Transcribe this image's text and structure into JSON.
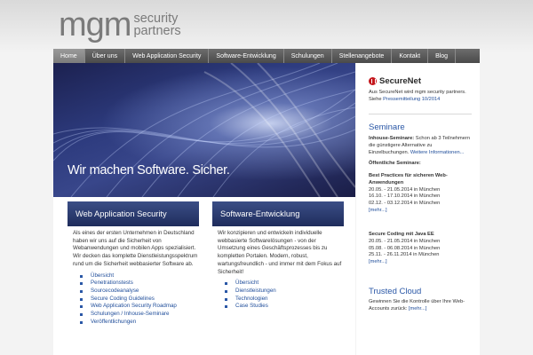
{
  "logo": {
    "main": "mgm",
    "sub1": "security",
    "sub2": "partners"
  },
  "nav": [
    {
      "label": "Home",
      "active": true
    },
    {
      "label": "Über uns",
      "active": false
    },
    {
      "label": "Web Application Security",
      "active": false
    },
    {
      "label": "Software-Entwicklung",
      "active": false
    },
    {
      "label": "Schulungen",
      "active": false
    },
    {
      "label": "Stellenangebote",
      "active": false
    },
    {
      "label": "Kontakt",
      "active": false
    },
    {
      "label": "Blog",
      "active": false
    }
  ],
  "hero": {
    "title": "Wir machen Software. Sicher."
  },
  "col1": {
    "heading": "Web Application Security",
    "text": "Als eines der ersten Unternehmen in Deutschland haben wir uns auf die Sicherheit von Webanwendungen und mobilen Apps spezialisiert. Wir decken das komplette Dienstleistungsspektrum rund um die Sicherheit webbasierter Software ab.",
    "links": [
      "Übersicht",
      "Penetrationstests",
      "Sourcecodeanalyse",
      "Secure Coding Guidelines",
      "Web Application Security Roadmap",
      "Schulungen / Inhouse-Seminare",
      "Veröffentlichungen"
    ]
  },
  "col2": {
    "heading": "Software-Entwicklung",
    "text": "Wir konzipieren und entwickeln individuelle webbasierte Softwarelösungen - von der Umsetzung eines Geschäftsprozesses bis zu kompletten Portalen. Modern, robust, wartungsfreundlich - und immer mit dem Fokus auf Sicherheit!",
    "links": [
      "Übersicht",
      "Dienstleistungen",
      "Technologien",
      "Case Studies"
    ]
  },
  "sidebar": {
    "securenet_title": "SecureNet",
    "securenet_text": "Aus SecureNet wird mgm security partners. Siehe ",
    "securenet_link": "Pressemitteilung 10/2014",
    "seminare_heading": "Seminare",
    "inhouse_bold": "Inhouse-Seminare:",
    "inhouse_text": " Schon ab 3 Teilnehmern die günstigere Alternative zu Einzelbuchungen. ",
    "inhouse_link": "Weitere Informationen...",
    "open_heading": "Öffentliche Seminare:",
    "course1_title": "Best Practices für sicheren Web-Anwendungen",
    "course1_dates": [
      "20.05. - 21.05.2014 in München",
      "16.10. - 17.10.2014 in München",
      "02.12. - 03.12.2014 in München"
    ],
    "more1": "[mehr...]",
    "course2_title": "Secure Coding mit Java EE",
    "course2_dates": [
      "20.05. - 21.05.2014 in München",
      "05.08. - 06.08.2014 in München",
      "25.11. - 26.11.2014 in München"
    ],
    "more2": "[mehr...]",
    "trusted_heading": "Trusted Cloud",
    "trusted_text": "Gewinnen Sie die Kontrolle über Ihre Web-Accounts zurück: ",
    "trusted_link": "[mehr...]"
  }
}
